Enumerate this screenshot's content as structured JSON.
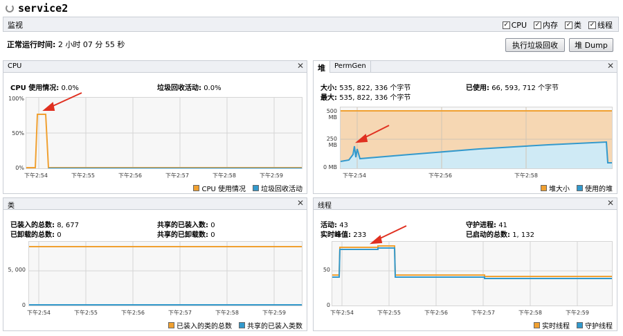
{
  "app": {
    "title": "service2"
  },
  "monitor": {
    "label": "监视",
    "checkboxes": [
      {
        "label": "CPU",
        "checked": true
      },
      {
        "label": "内存",
        "checked": true
      },
      {
        "label": "类",
        "checked": true
      },
      {
        "label": "线程",
        "checked": true
      }
    ]
  },
  "uptime": {
    "label": "正常运行时间:",
    "value": "2 小时 07 分 55 秒"
  },
  "buttons": {
    "gc": "执行垃圾回收",
    "heap_dump": "堆 Dump"
  },
  "cpu": {
    "title": "CPU",
    "usage_label": "CPU 使用情况:",
    "usage_value": "0.0%",
    "gc_label": "垃圾回收活动:",
    "gc_value": "0.0%",
    "yticks": [
      "100%",
      "50%",
      "0%"
    ],
    "xticks": [
      "下午2:54",
      "下午2:55",
      "下午2:56",
      "下午2:57",
      "下午2:58",
      "下午2:59"
    ],
    "legend": [
      {
        "label": "CPU 使用情况",
        "color": "#f0a030"
      },
      {
        "label": "垃圾回收活动",
        "color": "#3399cc"
      }
    ]
  },
  "heap": {
    "tabs": [
      "堆",
      "PermGen"
    ],
    "size_label": "大小:",
    "size_value": "535, 822, 336 个字节",
    "max_label": "最大:",
    "max_value": "535, 822, 336 个字节",
    "used_label": "已使用:",
    "used_value": "66, 593, 712 个字节",
    "yticks": [
      "500 MB",
      "250 MB",
      "0 MB"
    ],
    "xticks": [
      "下午2:54",
      "下午2:56",
      "下午2:58"
    ],
    "legend": [
      {
        "label": "堆大小",
        "color": "#f0a030"
      },
      {
        "label": "使用的堆",
        "color": "#3399cc"
      }
    ]
  },
  "classes": {
    "title": "类",
    "loaded_label": "已装入的总数:",
    "loaded_value": "8, 677",
    "unloaded_label": "已卸载的总数:",
    "unloaded_value": "0",
    "shared_loaded_label": "共享的已装入数:",
    "shared_loaded_value": "0",
    "shared_unloaded_label": "共享的已卸载数:",
    "shared_unloaded_value": "0",
    "yticks": [
      "5, 000",
      "0"
    ],
    "xticks": [
      "下午2:54",
      "下午2:55",
      "下午2:56",
      "下午2:57",
      "下午2:58",
      "下午2:59"
    ],
    "legend": [
      {
        "label": "已装入的类的总数",
        "color": "#f0a030"
      },
      {
        "label": "共享的已装入类数",
        "color": "#3399cc"
      }
    ]
  },
  "threads": {
    "title": "线程",
    "live_label": "活动:",
    "live_value": "43",
    "peak_label": "实时峰值:",
    "peak_value": "233",
    "daemon_label": "守护进程:",
    "daemon_value": "41",
    "started_label": "已启动的总数:",
    "started_value": "1, 132",
    "yticks": [
      "50",
      "0"
    ],
    "xticks": [
      "下午2:54",
      "下午2:55",
      "下午2:56",
      "下午2:57",
      "下午2:58",
      "下午2:59"
    ],
    "legend": [
      {
        "label": "实时线程",
        "color": "#f0a030"
      },
      {
        "label": "守护线程",
        "color": "#3399cc"
      }
    ]
  },
  "colors": {
    "accent_orange": "#f0a030",
    "accent_blue": "#3399cc",
    "arrow_red": "#e03020"
  }
}
